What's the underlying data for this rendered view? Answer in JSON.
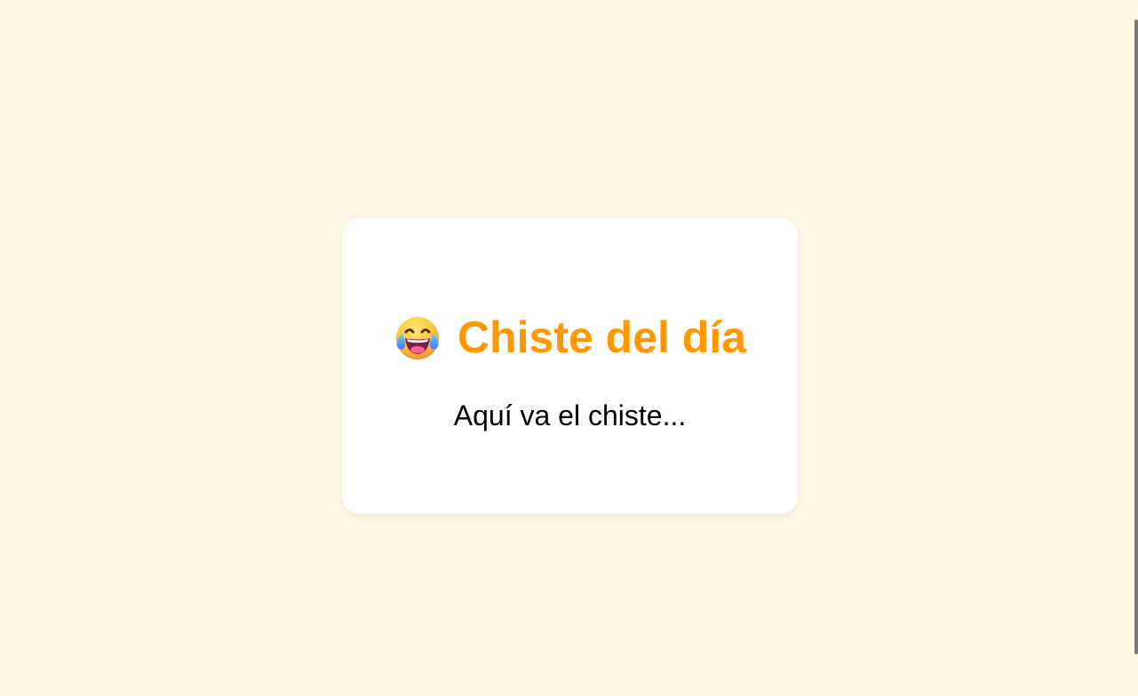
{
  "card": {
    "title": "Chiste del día",
    "icon": "laughing-tears-emoji-icon",
    "joke": "Aquí va el chiste..."
  },
  "colors": {
    "background": "#fff9e6",
    "card": "#ffffff",
    "title": "#ff9800",
    "text": "#000000"
  }
}
